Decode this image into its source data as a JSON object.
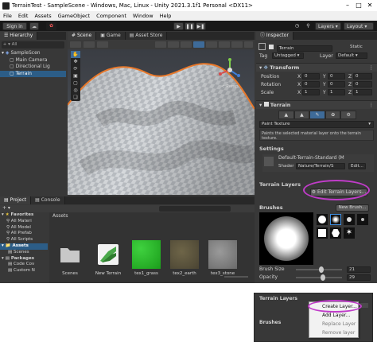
{
  "window": {
    "title": "TerrainTest - SampleScene - Windows, Mac, Linux - Unity 2021.3.1f1 Personal <DX11>"
  },
  "menubar": [
    "File",
    "Edit",
    "Assets",
    "GameObject",
    "Component",
    "Window",
    "Help"
  ],
  "toolbar": {
    "sign_in": "Sign in",
    "layers": "Layers",
    "layout": "Layout"
  },
  "hierarchy": {
    "tab": "Hierarchy",
    "search_placeholder": "All",
    "items": [
      {
        "label": "SampleScen",
        "indent": 0,
        "selected": false
      },
      {
        "label": "Main Camera",
        "indent": 1,
        "selected": false
      },
      {
        "label": "Directional Lig",
        "indent": 1,
        "selected": false
      },
      {
        "label": "Terrain",
        "indent": 1,
        "selected": true
      }
    ]
  },
  "scene": {
    "tabs": [
      "Scene",
      "Game",
      "Asset Store"
    ],
    "gizmo_label": "< Persp"
  },
  "inspector": {
    "tab": "Inspector",
    "object_name": "Terrain",
    "static_label": "Static",
    "tag_label": "Tag",
    "tag_value": "Untagged",
    "layer_label": "Layer",
    "layer_value": "Default",
    "transform": {
      "title": "Transform",
      "rows": [
        {
          "label": "Position",
          "x": "0",
          "y": "0",
          "z": "0"
        },
        {
          "label": "Rotation",
          "x": "0",
          "y": "0",
          "z": "0"
        },
        {
          "label": "Scale",
          "x": "1",
          "y": "1",
          "z": "1"
        }
      ]
    },
    "terrain": {
      "title": "Terrain",
      "mode": "Paint Texture",
      "help": "Paints the selected material layer onto the terrain texture.",
      "settings_title": "Settings",
      "material": "Default-Terrain-Standard (M",
      "shader_label": "Shader",
      "shader_value": "Nature/Terrain/S",
      "edit_label": "Edit...",
      "layers_title": "Terrain Layers",
      "edit_layers_button": "Edit Terrain Layers...",
      "brushes_title": "Brushes",
      "new_brush_button": "New Brush...",
      "brush_size_label": "Brush Size",
      "brush_size_value": "21",
      "opacity_label": "Opacity",
      "opacity_value": "29",
      "brush_size_fraction": 0.55,
      "opacity_fraction": 0.6
    }
  },
  "project": {
    "tabs": [
      "Project",
      "Console"
    ],
    "tree": [
      {
        "label": "Favorites",
        "indent": 0,
        "bold": true
      },
      {
        "label": "All Materi",
        "indent": 1
      },
      {
        "label": "All Model",
        "indent": 1
      },
      {
        "label": "All Prefab",
        "indent": 1
      },
      {
        "label": "All Scripts",
        "indent": 1
      },
      {
        "label": "Assets",
        "indent": 0,
        "bold": true,
        "selected": true
      },
      {
        "label": "Scenes",
        "indent": 1
      },
      {
        "label": "Packages",
        "indent": 0,
        "bold": true
      },
      {
        "label": "Code Cov",
        "indent": 1
      },
      {
        "label": "Custom N",
        "indent": 1
      }
    ],
    "breadcrumb": "Assets",
    "items": [
      {
        "label": "Scenes",
        "kind": "folder"
      },
      {
        "label": "New Terrain",
        "kind": "terrain"
      },
      {
        "label": "tex1_grass",
        "kind": "grass"
      },
      {
        "label": "tex2_earth",
        "kind": "earth"
      },
      {
        "label": "tex3_stone",
        "kind": "stone"
      }
    ]
  },
  "popup": {
    "layers_title": "Terrain Layers",
    "brushes_title": "Brushes",
    "menu": [
      {
        "label": "Create Layer...",
        "enabled": true
      },
      {
        "label": "Add Layer...",
        "enabled": true
      },
      {
        "label": "Replace Layer",
        "enabled": false
      },
      {
        "label": "Remove layer",
        "enabled": false
      }
    ]
  },
  "colors": {
    "selection": "#2c5d87",
    "highlight_circle": "#c03cc9",
    "terrain_orange": "#e8782a"
  }
}
